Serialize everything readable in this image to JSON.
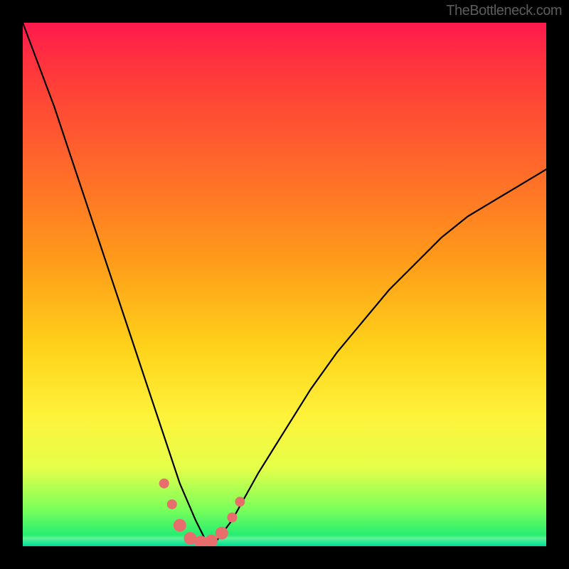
{
  "watermark": {
    "text": "TheBottleneck.com"
  },
  "chart_data": {
    "type": "line",
    "title": "",
    "xlabel": "",
    "ylabel": "",
    "xlim": [
      0,
      100
    ],
    "ylim": [
      0,
      100
    ],
    "grid": false,
    "legend": false,
    "series": [
      {
        "name": "bottleneck-curve",
        "x": [
          0,
          3,
          6,
          9,
          12,
          15,
          18,
          21,
          24,
          27,
          30,
          33,
          35,
          37,
          40,
          45,
          50,
          55,
          60,
          65,
          70,
          75,
          80,
          85,
          90,
          95,
          100
        ],
        "values": [
          100,
          92,
          84,
          75,
          66,
          57,
          48,
          39,
          30,
          21,
          12,
          5,
          1,
          1,
          5,
          14,
          22,
          30,
          37,
          43,
          49,
          54,
          59,
          63,
          66,
          69,
          72
        ]
      }
    ],
    "markers": {
      "name": "highlighted-points",
      "color": "#e86e6e",
      "radius_large": 9,
      "radius_small": 7,
      "points": [
        {
          "x": 27.0,
          "y": 12.0,
          "r": "small"
        },
        {
          "x": 28.5,
          "y": 8.0,
          "r": "small"
        },
        {
          "x": 30.0,
          "y": 4.0,
          "r": "large"
        },
        {
          "x": 32.0,
          "y": 1.5,
          "r": "large"
        },
        {
          "x": 34.0,
          "y": 0.8,
          "r": "large"
        },
        {
          "x": 36.0,
          "y": 1.0,
          "r": "large"
        },
        {
          "x": 38.0,
          "y": 2.5,
          "r": "large"
        },
        {
          "x": 40.0,
          "y": 5.5,
          "r": "small"
        },
        {
          "x": 41.5,
          "y": 8.5,
          "r": "small"
        }
      ]
    },
    "background": {
      "type": "vertical-gradient",
      "stops": [
        {
          "pos": 0.0,
          "color": "#ff1a4d"
        },
        {
          "pos": 0.28,
          "color": "#ff6a2a"
        },
        {
          "pos": 0.62,
          "color": "#ffd21a"
        },
        {
          "pos": 0.85,
          "color": "#e6ff4a"
        },
        {
          "pos": 1.0,
          "color": "#00e67a"
        }
      ]
    }
  }
}
